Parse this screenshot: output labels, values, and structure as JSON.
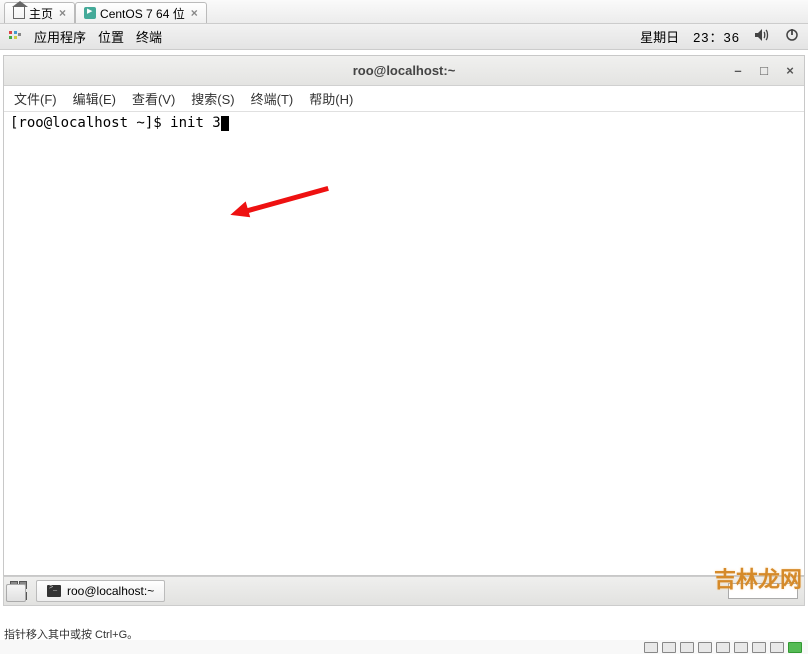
{
  "vm_tabs": {
    "home": "主页",
    "centos": "CentOS 7 64 位"
  },
  "gnome_panel": {
    "apps": "应用程序",
    "places": "位置",
    "terminal": "终端",
    "weekday": "星期日",
    "time": "23：36"
  },
  "terminal": {
    "title": "roo@localhost:~",
    "menus": {
      "file": "文件(F)",
      "edit": "编辑(E)",
      "view": "查看(V)",
      "search": "搜索(S)",
      "terminal": "终端(T)",
      "help": "帮助(H)"
    },
    "prompt": "[roo@localhost ~]$ ",
    "command": "init 3"
  },
  "taskbar": {
    "task_label": "roo@localhost:~"
  },
  "watermark": "吉林龙网",
  "vm_status": "指针移入其中或按 Ctrl+G。"
}
